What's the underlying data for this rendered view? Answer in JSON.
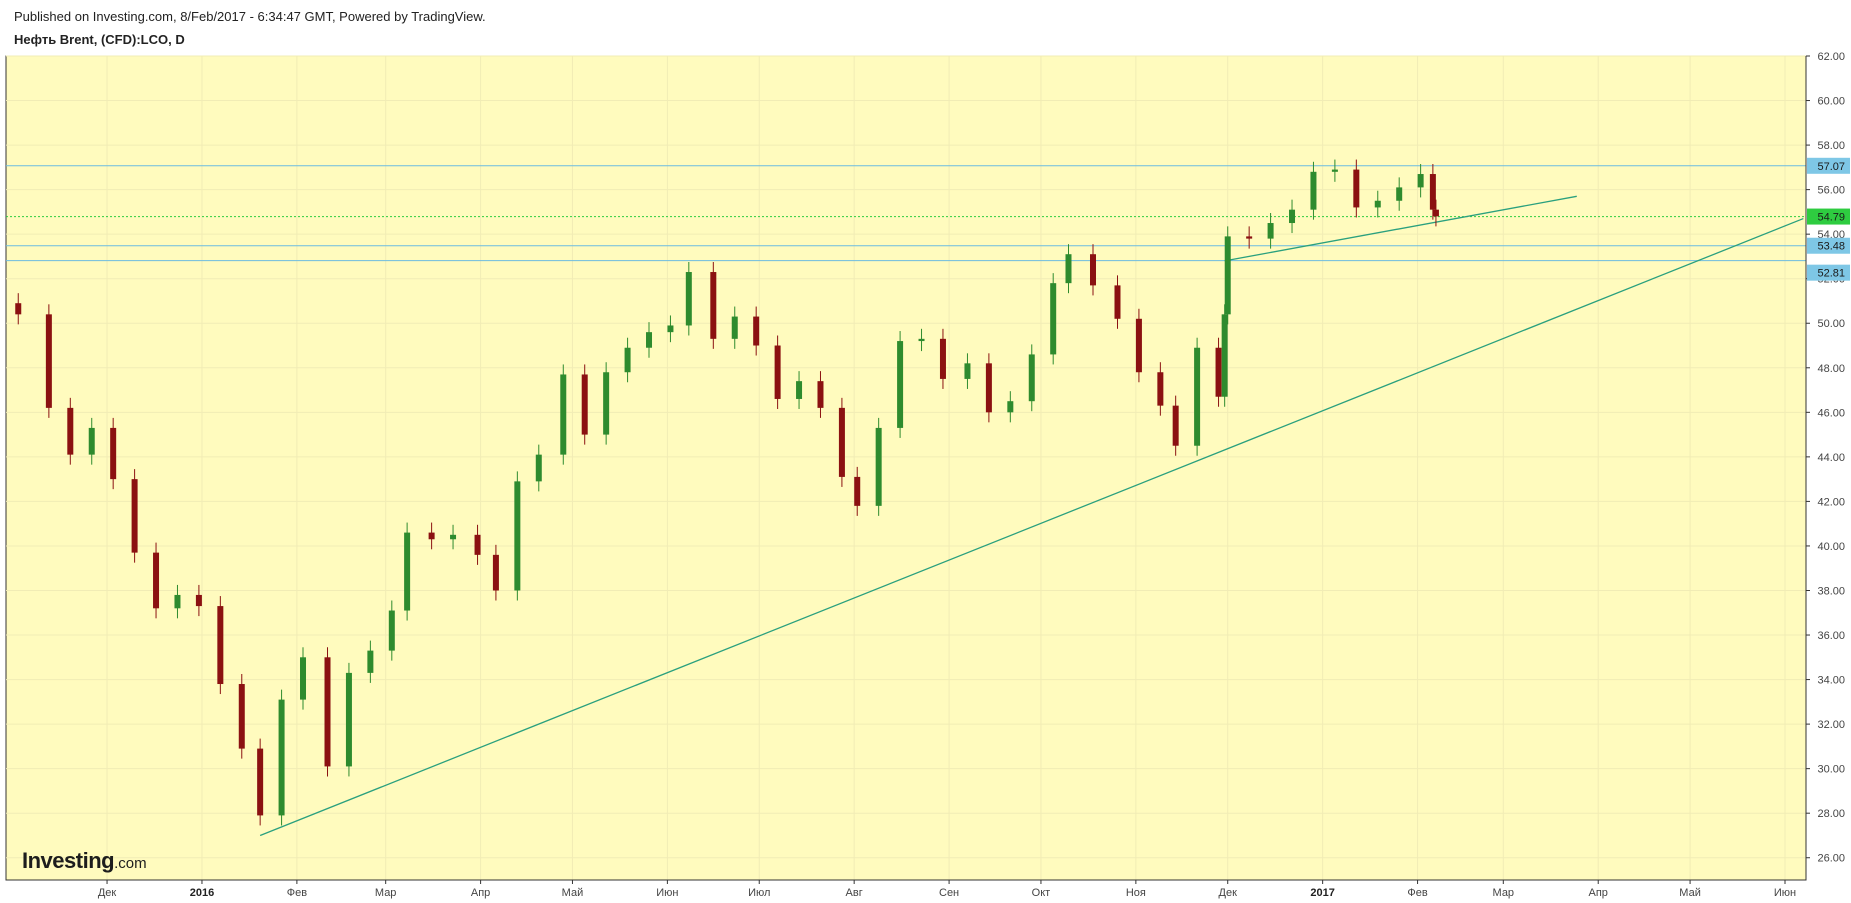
{
  "header": {
    "published": "Published on Investing.com, 8/Feb/2017 - 6:34:47 GMT, Powered by TradingView.",
    "symbol": "Нефть Brent, (CFD):LCO, D"
  },
  "logo": {
    "main": "Investing",
    "suffix": ".com"
  },
  "colors": {
    "plot_bg": "#fffbbe",
    "grid": "#f1ecb5",
    "up": "#2e8b2e",
    "down": "#8b1111",
    "trendline": "#2aa07e",
    "hline": "#6cbbe0",
    "last_price": "#2ecc40",
    "price_tag": "#7ec7e6"
  },
  "chart_data": {
    "type": "candlestick",
    "title": "Нефть Brent, (CFD):LCO, D",
    "y_axis": {
      "ticks": [
        26,
        28,
        30,
        32,
        34,
        36,
        38,
        40,
        42,
        44,
        46,
        48,
        50,
        52,
        54,
        56,
        58,
        60,
        62
      ],
      "tick_labels": [
        "26.00",
        "28.00",
        "30.00",
        "32.00",
        "34.00",
        "36.00",
        "38.00",
        "40.00",
        "42.00",
        "44.00",
        "46.00",
        "48.00",
        "50.00",
        "52.00",
        "54.00",
        "56.00",
        "58.00",
        "60.00",
        "62.00"
      ],
      "range": [
        25,
        62
      ]
    },
    "x_axis": {
      "labels": [
        {
          "t": "Дек",
          "date": "2015-12-01",
          "bold": false
        },
        {
          "t": "2016",
          "date": "2016-01-01",
          "bold": true
        },
        {
          "t": "Фев",
          "date": "2016-02-01",
          "bold": false
        },
        {
          "t": "Мар",
          "date": "2016-03-01",
          "bold": false
        },
        {
          "t": "Апр",
          "date": "2016-04-01",
          "bold": false
        },
        {
          "t": "Май",
          "date": "2016-05-01",
          "bold": false
        },
        {
          "t": "Июн",
          "date": "2016-06-01",
          "bold": false
        },
        {
          "t": "Июл",
          "date": "2016-07-01",
          "bold": false
        },
        {
          "t": "Авг",
          "date": "2016-08-01",
          "bold": false
        },
        {
          "t": "Сен",
          "date": "2016-09-01",
          "bold": false
        },
        {
          "t": "Окт",
          "date": "2016-10-01",
          "bold": false
        },
        {
          "t": "Ноя",
          "date": "2016-11-01",
          "bold": false
        },
        {
          "t": "Дек",
          "date": "2016-12-01",
          "bold": false
        },
        {
          "t": "2017",
          "date": "2017-01-01",
          "bold": true
        },
        {
          "t": "Фев",
          "date": "2017-02-01",
          "bold": false
        },
        {
          "t": "Мар",
          "date": "2017-03-01",
          "bold": false
        },
        {
          "t": "Апр",
          "date": "2017-04-01",
          "bold": false
        },
        {
          "t": "Май",
          "date": "2017-05-01",
          "bold": false
        },
        {
          "t": "Июн",
          "date": "2017-06-01",
          "bold": false
        }
      ]
    },
    "price_tags": [
      {
        "label": "57.07",
        "value": 57.07,
        "kind": "hline"
      },
      {
        "label": "54.79",
        "value": 54.79,
        "kind": "last"
      },
      {
        "label": "53.48",
        "value": 53.48,
        "kind": "hline"
      },
      {
        "label": "52.81",
        "value": 52.81,
        "kind": "hline"
      }
    ],
    "trendlines": [
      {
        "from": {
          "date": "2016-01-20",
          "value": 27.0
        },
        "to": {
          "date": "2017-06-07",
          "value": 54.7
        }
      },
      {
        "from": {
          "date": "2016-11-30",
          "value": 52.8
        },
        "to": {
          "date": "2017-03-25",
          "value": 55.7
        }
      }
    ],
    "candles_close": [
      {
        "date": "2015-11-02",
        "close": 50.4
      },
      {
        "date": "2015-11-12",
        "close": 46.2
      },
      {
        "date": "2015-11-19",
        "close": 44.1
      },
      {
        "date": "2015-11-26",
        "close": 45.3
      },
      {
        "date": "2015-12-03",
        "close": 43.0
      },
      {
        "date": "2015-12-10",
        "close": 39.7
      },
      {
        "date": "2015-12-17",
        "close": 37.2
      },
      {
        "date": "2015-12-24",
        "close": 37.8
      },
      {
        "date": "2015-12-31",
        "close": 37.3
      },
      {
        "date": "2016-01-07",
        "close": 33.8
      },
      {
        "date": "2016-01-14",
        "close": 30.9
      },
      {
        "date": "2016-01-20",
        "close": 27.9
      },
      {
        "date": "2016-01-27",
        "close": 33.1
      },
      {
        "date": "2016-02-03",
        "close": 35.0
      },
      {
        "date": "2016-02-11",
        "close": 30.1
      },
      {
        "date": "2016-02-18",
        "close": 34.3
      },
      {
        "date": "2016-02-25",
        "close": 35.3
      },
      {
        "date": "2016-03-03",
        "close": 37.1
      },
      {
        "date": "2016-03-08",
        "close": 40.6
      },
      {
        "date": "2016-03-16",
        "close": 40.3
      },
      {
        "date": "2016-03-23",
        "close": 40.5
      },
      {
        "date": "2016-03-31",
        "close": 39.6
      },
      {
        "date": "2016-04-06",
        "close": 38.0
      },
      {
        "date": "2016-04-13",
        "close": 42.9
      },
      {
        "date": "2016-04-20",
        "close": 44.1
      },
      {
        "date": "2016-04-28",
        "close": 47.7
      },
      {
        "date": "2016-05-05",
        "close": 45.0
      },
      {
        "date": "2016-05-12",
        "close": 47.8
      },
      {
        "date": "2016-05-19",
        "close": 48.9
      },
      {
        "date": "2016-05-26",
        "close": 49.6
      },
      {
        "date": "2016-06-02",
        "close": 49.9
      },
      {
        "date": "2016-06-08",
        "close": 52.3
      },
      {
        "date": "2016-06-16",
        "close": 49.3
      },
      {
        "date": "2016-06-23",
        "close": 50.3
      },
      {
        "date": "2016-06-30",
        "close": 49.0
      },
      {
        "date": "2016-07-07",
        "close": 46.6
      },
      {
        "date": "2016-07-14",
        "close": 47.4
      },
      {
        "date": "2016-07-21",
        "close": 46.2
      },
      {
        "date": "2016-07-28",
        "close": 43.1
      },
      {
        "date": "2016-08-02",
        "close": 41.8
      },
      {
        "date": "2016-08-09",
        "close": 45.3
      },
      {
        "date": "2016-08-16",
        "close": 49.2
      },
      {
        "date": "2016-08-23",
        "close": 49.3
      },
      {
        "date": "2016-08-30",
        "close": 47.5
      },
      {
        "date": "2016-09-07",
        "close": 48.2
      },
      {
        "date": "2016-09-14",
        "close": 46.0
      },
      {
        "date": "2016-09-21",
        "close": 46.5
      },
      {
        "date": "2016-09-28",
        "close": 48.6
      },
      {
        "date": "2016-10-05",
        "close": 51.8
      },
      {
        "date": "2016-10-10",
        "close": 53.1
      },
      {
        "date": "2016-10-18",
        "close": 51.7
      },
      {
        "date": "2016-10-26",
        "close": 50.2
      },
      {
        "date": "2016-11-02",
        "close": 47.8
      },
      {
        "date": "2016-11-09",
        "close": 46.3
      },
      {
        "date": "2016-11-14",
        "close": 44.5
      },
      {
        "date": "2016-11-21",
        "close": 48.9
      },
      {
        "date": "2016-11-28",
        "close": 46.7
      },
      {
        "date": "2016-11-30",
        "close": 50.4
      },
      {
        "date": "2016-12-01",
        "close": 53.9
      },
      {
        "date": "2016-12-08",
        "close": 53.8
      },
      {
        "date": "2016-12-15",
        "close": 54.5
      },
      {
        "date": "2016-12-22",
        "close": 55.1
      },
      {
        "date": "2016-12-29",
        "close": 56.8
      },
      {
        "date": "2017-01-05",
        "close": 56.9
      },
      {
        "date": "2017-01-12",
        "close": 55.2
      },
      {
        "date": "2017-01-19",
        "close": 55.5
      },
      {
        "date": "2017-01-26",
        "close": 56.1
      },
      {
        "date": "2017-02-02",
        "close": 56.7
      },
      {
        "date": "2017-02-06",
        "close": 55.1
      },
      {
        "date": "2017-02-07",
        "close": 54.8
      }
    ]
  }
}
